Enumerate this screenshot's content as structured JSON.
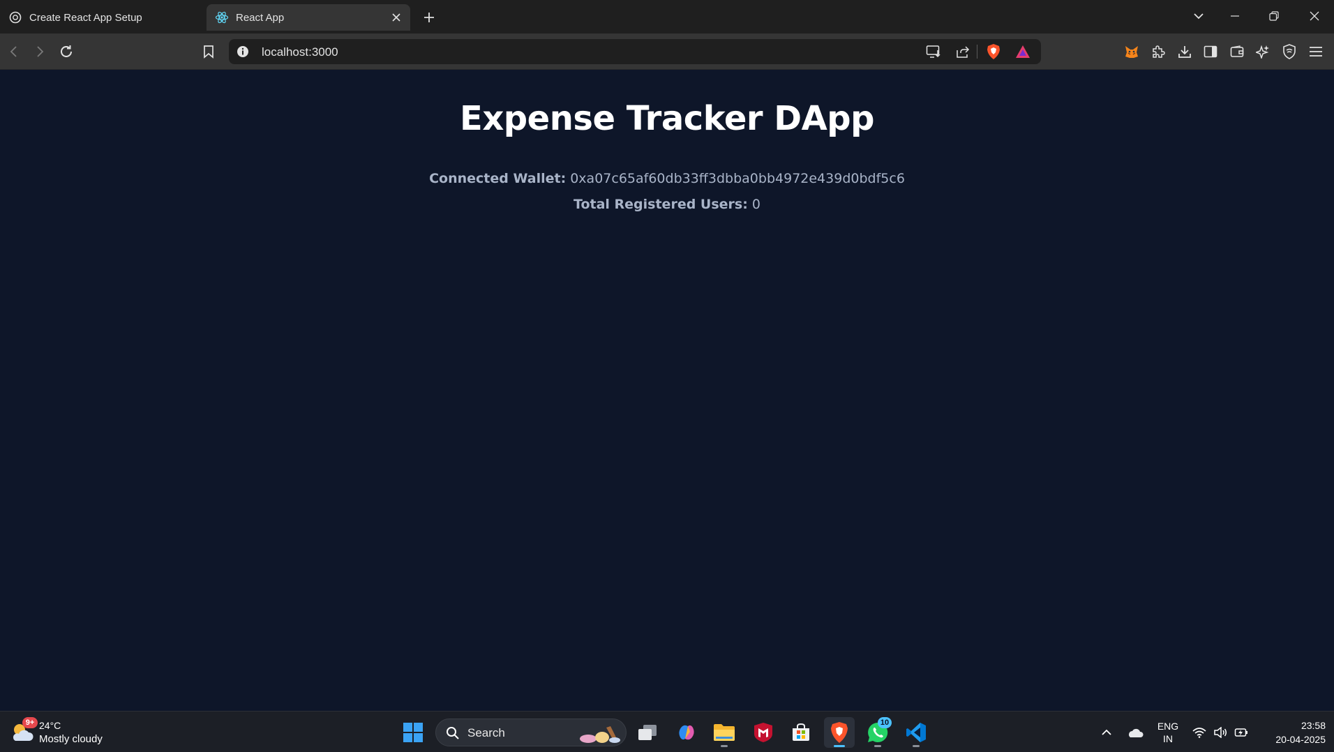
{
  "browser": {
    "tabs": [
      {
        "title": "Create React App Setup",
        "active": false
      },
      {
        "title": "React App",
        "active": true
      }
    ],
    "address_bar": {
      "url": "localhost:3000"
    }
  },
  "page": {
    "title": "Expense Tracker DApp",
    "wallet_label": "Connected Wallet:",
    "wallet_address": "0xa07c65af60db33ff3dbba0bb4972e439d0bdf5c6",
    "users_label": "Total Registered Users:",
    "users_count": "0"
  },
  "taskbar": {
    "weather": {
      "badge": "9+",
      "temperature": "24°C",
      "condition": "Mostly cloudy"
    },
    "search_placeholder": "Search",
    "whatsapp_badge": "10",
    "language": {
      "line1": "ENG",
      "line2": "IN"
    },
    "clock": {
      "time": "23:58",
      "date": "20-04-2025"
    }
  },
  "colors": {
    "page_background": "#0e1629",
    "title_text": "#ffffff",
    "info_text": "#a9b4c8",
    "tabstrip": "#1f1f1f",
    "toolbar": "#353535",
    "taskbar": "#1c1f26",
    "accent": "#4cc2ff"
  }
}
